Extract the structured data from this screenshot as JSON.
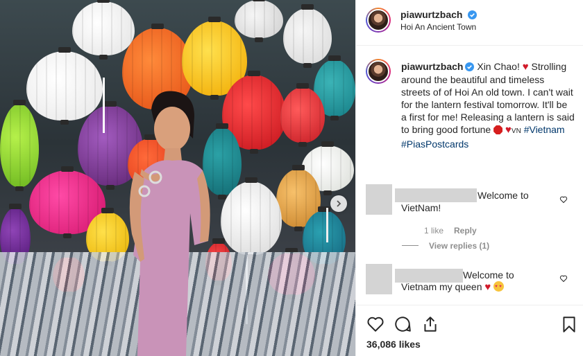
{
  "header": {
    "username": "piawurtzbach",
    "location": "Hoi An Ancient Town"
  },
  "caption": {
    "username": "piawurtzbach",
    "greeting": "Xin Chao!",
    "line1": "Strolling around the beautiful and timeless streets of of Hoi An old town. I can't wait for the lantern festival tomorrow. It'll be a first for me! Releasing a lantern is said to bring good fortune",
    "flag_text": "VN",
    "hashtag1": "#Vietnam",
    "hashtag2": "#PiasPostcards"
  },
  "comments": [
    {
      "text_line1": "Welcome to",
      "text_line2": "VietNam!",
      "likes": "1 like",
      "reply": "Reply",
      "view_replies": "View replies (1)"
    },
    {
      "text_line1": "Welcome to",
      "text_line2": "Vietnam my queen"
    }
  ],
  "footer": {
    "likes": "36,086 likes"
  },
  "icons": {
    "like": "heart-icon",
    "comment": "comment-icon",
    "share": "share-icon",
    "save": "bookmark-icon",
    "next": "chevron-right-icon",
    "verified": "verified-badge-icon"
  },
  "colors": {
    "hashtag": "#00376b",
    "verified": "#3897f0",
    "text": "#262626",
    "muted": "#8e8e8e"
  }
}
